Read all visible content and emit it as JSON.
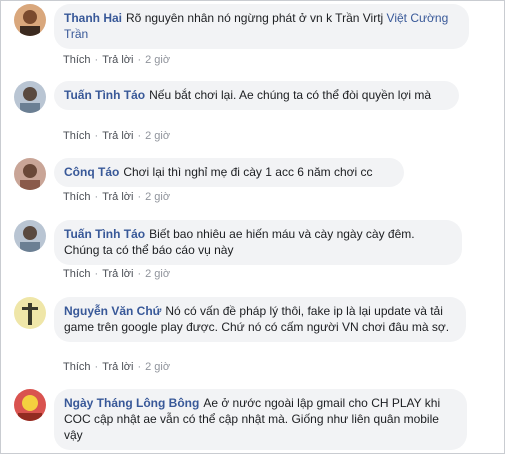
{
  "comments": [
    {
      "author": "Thanh Hai",
      "text": "Rõ nguyên nhân nó ngừng phát ở vn k Trần Virtj ",
      "mention": "Việt Cường Trần",
      "actions": {
        "like": "Thích",
        "reply": "Trả lời",
        "time": "2 giờ"
      },
      "avatar_color": "#c9885a"
    },
    {
      "author": "Tuấn Tình Táo",
      "text": "Nếu bắt chơi lại. Ae chúng ta có thể đòi quyền lợi mà",
      "actions": {
        "like": "Thích",
        "reply": "Trả lời",
        "time": "2 giờ"
      },
      "avatar_color": "#8fa0b4"
    },
    {
      "author": "Cônq Táo",
      "text": "Chơi lại thì nghỉ mẹ đi cày 1 acc 6 năm chơi cc",
      "actions": {
        "like": "Thích",
        "reply": "Trả lời",
        "time": "2 giờ"
      },
      "avatar_color": "#b08a7a"
    },
    {
      "author": "Tuấn Tình Táo",
      "text": "Biết bao nhiêu ae hiến máu và cày ngày cày đêm. Chúng ta có thể báo cáo vụ này",
      "actions": {
        "like": "Thích",
        "reply": "Trả lời",
        "time": "2 giờ"
      },
      "avatar_color": "#8fa0b4"
    },
    {
      "author": "Nguyễn Văn Chứ",
      "text": "Nó có vấn đề pháp lý thôi, fake ip là lại update và tải game trên google play được. Chứ nó có cấm người VN chơi đâu mà sợ.",
      "actions": {
        "like": "Thích",
        "reply": "Trả lời",
        "time": "2 giờ"
      },
      "avatar_color": "#e8d36a"
    },
    {
      "author": "Ngày Tháng Lông Bông",
      "text": "Ae ở nước ngoài lập gmail cho CH PLAY khi COC cập nhật ae vẫn có thể cập nhật mà. Giống như liên quân mobile vậy",
      "actions": {
        "like": "Thích",
        "reply": "Trả lời",
        "time": "2 giờ"
      },
      "avatar_color": "#c0392b"
    }
  ]
}
